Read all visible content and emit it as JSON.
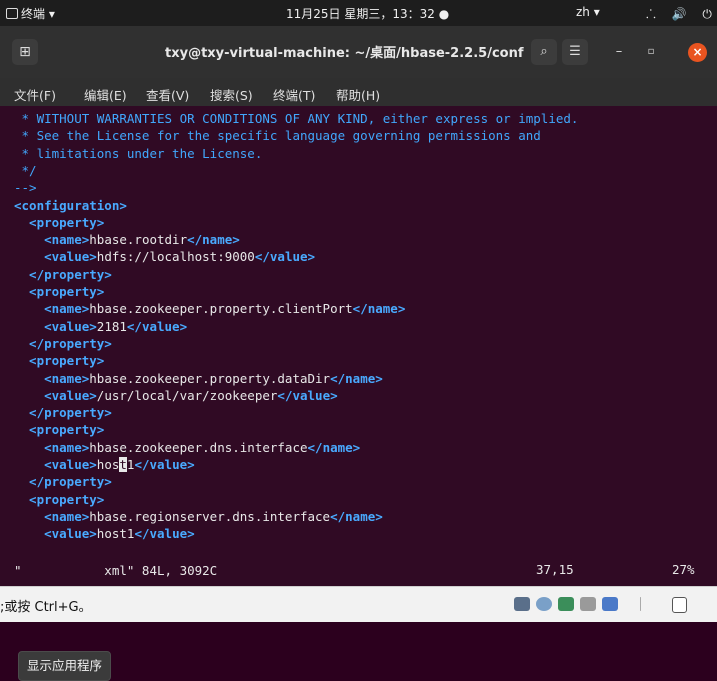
{
  "topbar": {
    "activities": "终端 ▾",
    "clock": "11月25日 星期三，13：32 ●",
    "lang": "zh ▾",
    "sys_icons": "⸫ 🔊 ⏻ ▾"
  },
  "titlebar": {
    "title": "txy@txy-virtual-machine: ~/桌面/hbase-2.2.5/conf",
    "new_tab": "⊞",
    "search": "⌕",
    "menu": "☰",
    "minimize": "–",
    "maximize": "▫",
    "close": "×"
  },
  "menu": {
    "file": "文件(F)",
    "edit": "编辑(E)",
    "view": "查看(V)",
    "search": "搜索(S)",
    "terminal": "终端(T)",
    "help": "帮助(H)"
  },
  "lines": [
    {
      "text": " * WITHOUT WARRANTIES OR CONDITIONS OF ANY KIND, either express or implied."
    },
    {
      "text": " * See the License for the specific language governing permissions and"
    },
    {
      "text": " * limitations under the License."
    },
    {
      "text": " */"
    },
    {
      "text": "-->"
    },
    {
      "text": "<configuration>"
    },
    {
      "text": "  <property>"
    },
    {
      "open": "    <name>",
      "val": "hbase.rootdir",
      "close": "</name>"
    },
    {
      "open": "    <value>",
      "val": "hdfs://localhost:9000",
      "close": "</value>"
    },
    {
      "text": "  </property>"
    },
    {
      "text": "  <property>"
    },
    {
      "open": "    <name>",
      "val": "hbase.zookeeper.property.clientPort",
      "close": "</name>"
    },
    {
      "open": "    <value>",
      "val": "2181",
      "close": "</value>"
    },
    {
      "text": "  </property>"
    },
    {
      "text": "  <property>"
    },
    {
      "open": "    <name>",
      "val": "hbase.zookeeper.property.dataDir",
      "close": "</name>"
    },
    {
      "open": "    <value>",
      "val": "/usr/local/var/zookeeper",
      "close": "</value>"
    },
    {
      "text": "  </property>"
    },
    {
      "text": "  <property>"
    },
    {
      "open": "    <name>",
      "val": "hbase.zookeeper.dns.interface",
      "close": "</name>"
    },
    {
      "open": "    <value>",
      "val_before": "hos",
      "cursor": "t",
      "val_after": "1",
      "close": "</value>"
    },
    {
      "text": "  </property>"
    },
    {
      "text": "  <property>"
    },
    {
      "open": "    <name>",
      "val": "hbase.regionserver.dns.interface",
      "close": "</name>"
    },
    {
      "open": "    <value>",
      "val": "host1",
      "close": "</value>"
    }
  ],
  "status": {
    "file": "\"           xml\" 84L, 3092C",
    "position": "37,15",
    "percent": "27%"
  },
  "tooltip": "显示应用程序",
  "host_hint": ";或按 Ctrl+G。",
  "colors": {
    "terminal_bg": "#300a24",
    "comment": "#41a7fc",
    "tag": "#49aaff",
    "close_button": "#e95420"
  }
}
